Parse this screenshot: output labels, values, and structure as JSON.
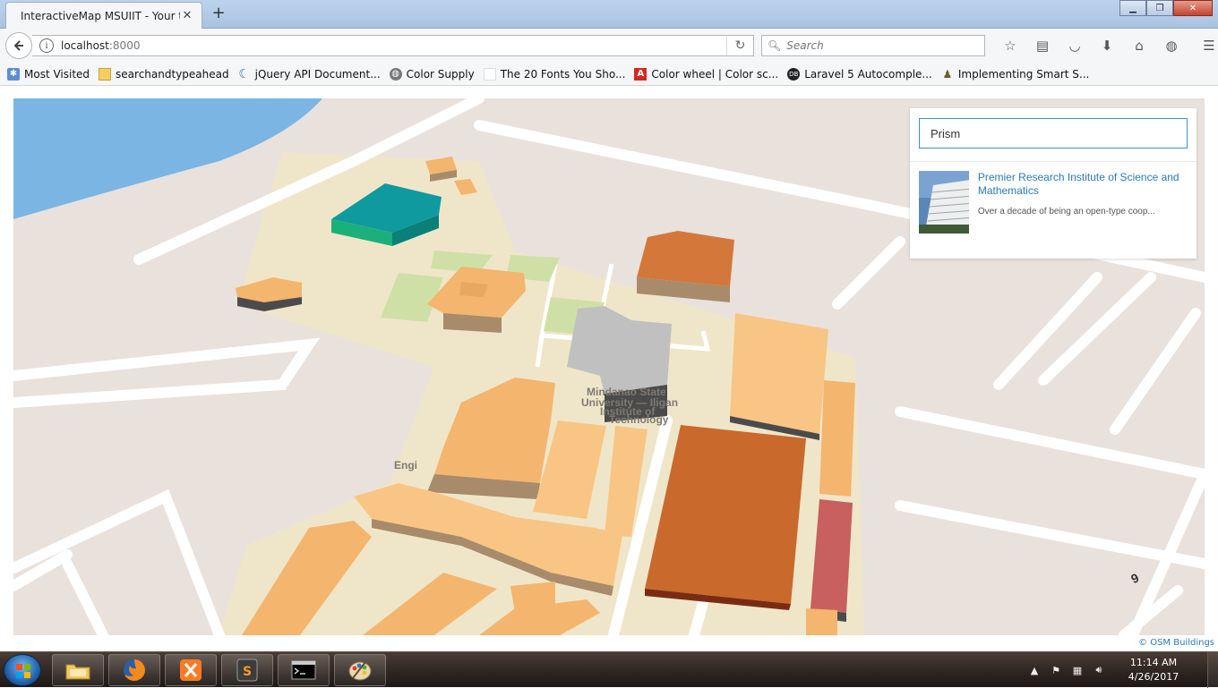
{
  "browser": {
    "tab_title": "InteractiveMap MSUIIT - Your title",
    "url_host": "localhost",
    "url_port": ":8000",
    "search_placeholder": "Search",
    "bookmarks": [
      {
        "label": "Most Visited",
        "icon": "most-visited-icon"
      },
      {
        "label": "searchandtypeahead",
        "icon": "folder-icon"
      },
      {
        "label": "jQuery API Document...",
        "icon": "jquery-icon"
      },
      {
        "label": "Color Supply",
        "icon": "globe-icon"
      },
      {
        "label": "The 20 Fonts You Sho...",
        "icon": "page-icon"
      },
      {
        "label": "Color wheel | Color sc...",
        "icon": "adobe-icon"
      },
      {
        "label": "Laravel 5 Autocomple...",
        "icon": "laravel-icon"
      },
      {
        "label": "Implementing Smart S...",
        "icon": "person-icon"
      }
    ]
  },
  "map": {
    "attribution": "© OSM Buildings",
    "labels": {
      "campus_line1": "Mindanao State",
      "campus_line2": "University — Iligan",
      "campus_line3": "Institute of",
      "campus_line4": "Technology",
      "engi": "Engi",
      "road_number": "9"
    },
    "colors": {
      "water": "#7ab5e4",
      "land": "#e9e1dc",
      "campus": "#efe6c9",
      "building": "#f4b56e",
      "building_side": "#a78b6b",
      "selected": "#c0c0c0",
      "highlight_teal": "#0f9aa0",
      "large_building": "#c96a2c",
      "red_building": "#c7605f"
    }
  },
  "search": {
    "query": "Prism",
    "result": {
      "title": "Premier Research Institute of Science and Mathematics",
      "description": "Over a decade of being an open-type coop..."
    }
  },
  "taskbar": {
    "time": "11:14 AM",
    "date": "4/26/2017",
    "apps": [
      "file-explorer",
      "firefox",
      "xampp",
      "sublime-text",
      "command-prompt",
      "paint"
    ]
  }
}
